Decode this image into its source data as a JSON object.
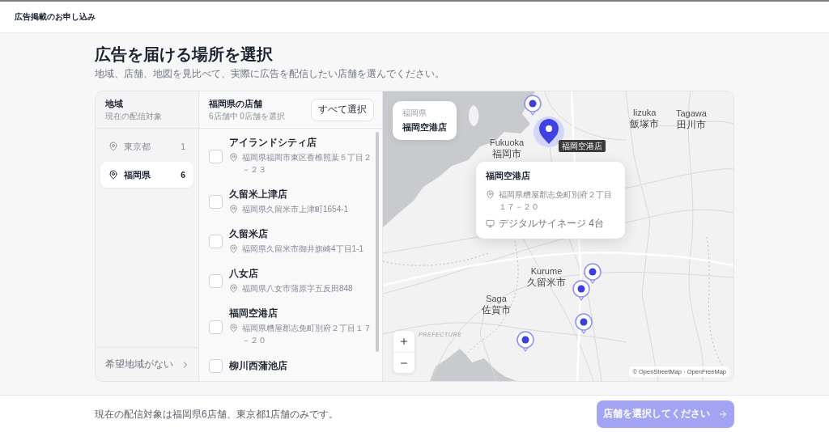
{
  "header": {
    "title": "広告掲載のお申し込み"
  },
  "intro": {
    "title": "広告を届ける場所を選択",
    "subtitle": "地域、店舗、地図を見比べて、実際に広告を配信したい店舗を選んでください。"
  },
  "regions": {
    "title": "地域",
    "subtitle": "現在の配信対象",
    "items": [
      {
        "name": "東京都",
        "count": "1",
        "selected": false
      },
      {
        "name": "福岡県",
        "count": "6",
        "selected": true
      }
    ],
    "footer_link": "希望地域がない"
  },
  "stores": {
    "title": "福岡県の店舗",
    "subtitle": "6店舗中 0店舗を選択",
    "select_all": "すべて選択",
    "items": [
      {
        "name": "アイランドシティ店",
        "address": "福岡県福岡市東区香椎照葉５丁目２－２３",
        "checked": false
      },
      {
        "name": "久留米上津店",
        "address": "福岡県久留米市上津町1654-1",
        "checked": false
      },
      {
        "name": "久留米店",
        "address": "福岡県久留米市御井旗崎4丁目1-1",
        "checked": false
      },
      {
        "name": "八女店",
        "address": "福岡県八女市蒲原字五反田848",
        "checked": false
      },
      {
        "name": "福岡空港店",
        "address": "福岡県糟屋郡志免町別府２丁目１７－２０",
        "checked": false
      },
      {
        "name": "柳川西蒲池店",
        "checked": false
      }
    ]
  },
  "map": {
    "info": {
      "region": "福岡県",
      "store": "福岡空港店"
    },
    "cities": [
      {
        "en": "Fukuoka",
        "ja": "福岡市"
      },
      {
        "en": "Iizuka",
        "ja": "飯塚市"
      },
      {
        "en": "Tagawa",
        "ja": "田川市"
      },
      {
        "en": "Kurume",
        "ja": "久留米市"
      },
      {
        "en": "Saga",
        "ja": "佐賀市"
      }
    ],
    "area_label": "PREFECTURE",
    "pins": [
      {
        "selected": false
      },
      {
        "selected": true,
        "label": "福岡空港店"
      },
      {
        "selected": false
      },
      {
        "selected": false
      },
      {
        "selected": false
      },
      {
        "selected": false
      }
    ],
    "popup": {
      "title": "福岡空港店",
      "address": "福岡県糟屋郡志免町別府２丁目１７－２０",
      "signage": "デジタルサイネージ 4台"
    },
    "attribution": "© OpenStreetMap · OpenFreeMap"
  },
  "footer": {
    "note": "現在の配信対象は福岡県6店舗、東京都1店舗のみです。",
    "button": {
      "label": "店舗を選択してください",
      "disabled": true
    }
  }
}
